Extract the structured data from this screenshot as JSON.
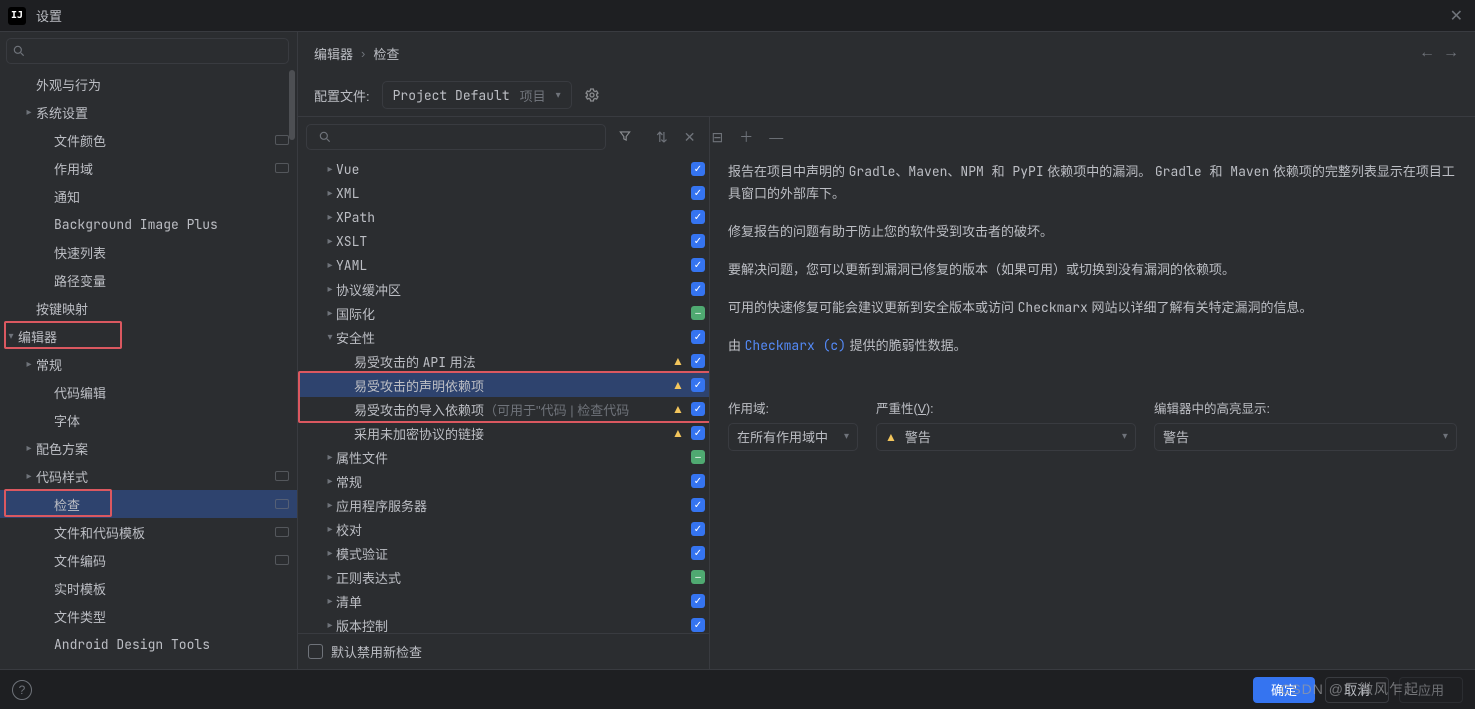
{
  "window": {
    "title": "设置",
    "app_icon_text": "IJ"
  },
  "search": {
    "placeholder": ""
  },
  "sidebar": {
    "items": [
      {
        "label": "外观与行为",
        "indent": 1,
        "chev": "",
        "badge": false
      },
      {
        "label": "系统设置",
        "indent": 1,
        "chev": "right",
        "badge": false
      },
      {
        "label": "文件颜色",
        "indent": 2,
        "chev": "",
        "badge": true
      },
      {
        "label": "作用域",
        "indent": 2,
        "chev": "",
        "badge": true
      },
      {
        "label": "通知",
        "indent": 2,
        "chev": "",
        "badge": false
      },
      {
        "label": "Background Image Plus",
        "indent": 2,
        "mono": true,
        "chev": "",
        "badge": false
      },
      {
        "label": "快速列表",
        "indent": 2,
        "chev": "",
        "badge": false
      },
      {
        "label": "路径变量",
        "indent": 2,
        "chev": "",
        "badge": false
      },
      {
        "label": "按键映射",
        "indent": 1,
        "chev": "",
        "badge": false
      },
      {
        "label": "编辑器",
        "indent": 0,
        "chev": "down",
        "badge": false,
        "hot": true
      },
      {
        "label": "常规",
        "indent": 1,
        "chev": "right",
        "badge": false
      },
      {
        "label": "代码编辑",
        "indent": 2,
        "chev": "",
        "badge": false
      },
      {
        "label": "字体",
        "indent": 2,
        "chev": "",
        "badge": false
      },
      {
        "label": "配色方案",
        "indent": 1,
        "chev": "right",
        "badge": false
      },
      {
        "label": "代码样式",
        "indent": 1,
        "chev": "right",
        "badge": true
      },
      {
        "label": "检查",
        "indent": 2,
        "chev": "",
        "badge": true,
        "selected": true,
        "hot": true
      },
      {
        "label": "文件和代码模板",
        "indent": 2,
        "chev": "",
        "badge": true
      },
      {
        "label": "文件编码",
        "indent": 2,
        "chev": "",
        "badge": true
      },
      {
        "label": "实时模板",
        "indent": 2,
        "chev": "",
        "badge": false
      },
      {
        "label": "文件类型",
        "indent": 2,
        "chev": "",
        "badge": false
      },
      {
        "label": "Android Design Tools",
        "indent": 2,
        "mono": true,
        "chev": "",
        "badge": false
      }
    ]
  },
  "breadcrumb": {
    "parent": "编辑器",
    "child": "检查"
  },
  "profile": {
    "label": "配置文件:",
    "name": "Project Default",
    "suffix": "项目"
  },
  "toolbar_icons": [
    "filter",
    "expand",
    "close",
    "collapse",
    "add",
    "sep"
  ],
  "inspections": [
    {
      "label": "Vue",
      "indent": 1,
      "arrow": "right",
      "chk": "on",
      "mono": true
    },
    {
      "label": "XML",
      "indent": 1,
      "arrow": "right",
      "chk": "on",
      "mono": true
    },
    {
      "label": "XPath",
      "indent": 1,
      "arrow": "right",
      "chk": "on",
      "mono": true
    },
    {
      "label": "XSLT",
      "indent": 1,
      "arrow": "right",
      "chk": "on",
      "mono": true
    },
    {
      "label": "YAML",
      "indent": 1,
      "arrow": "right",
      "chk": "on",
      "mono": true
    },
    {
      "label": "协议缓冲区",
      "indent": 1,
      "arrow": "right",
      "chk": "on"
    },
    {
      "label": "国际化",
      "indent": 1,
      "arrow": "right",
      "chk": "mixed"
    },
    {
      "label": "安全性",
      "indent": 1,
      "arrow": "down",
      "chk": "on"
    },
    {
      "label": "易受攻击的 API 用法",
      "indent": 2,
      "mono_part": true,
      "arrow": "",
      "chk": "on",
      "warn": true
    },
    {
      "label": "易受攻击的声明依赖项",
      "indent": 2,
      "arrow": "",
      "chk": "on",
      "warn": true,
      "selected": true
    },
    {
      "label": "易受攻击的导入依赖项",
      "suffix": "（可用于\"代码 | 检查代码",
      "indent": 2,
      "arrow": "",
      "chk": "on",
      "warn": true
    },
    {
      "label": "采用未加密协议的链接",
      "indent": 2,
      "arrow": "",
      "chk": "on",
      "warn": true
    },
    {
      "label": "属性文件",
      "indent": 1,
      "arrow": "right",
      "chk": "mixed"
    },
    {
      "label": "常规",
      "indent": 1,
      "arrow": "right",
      "chk": "on"
    },
    {
      "label": "应用程序服务器",
      "indent": 1,
      "arrow": "right",
      "chk": "on"
    },
    {
      "label": "校对",
      "indent": 1,
      "arrow": "right",
      "chk": "on"
    },
    {
      "label": "模式验证",
      "indent": 1,
      "arrow": "right",
      "chk": "on"
    },
    {
      "label": "正则表达式",
      "indent": 1,
      "arrow": "right",
      "chk": "mixed"
    },
    {
      "label": "清单",
      "indent": 1,
      "arrow": "right",
      "chk": "on"
    },
    {
      "label": "版本控制",
      "indent": 1,
      "arrow": "right",
      "chk": "on"
    }
  ],
  "disable_new": "默认禁用新检查",
  "desc": {
    "p1a": "报告在项目中声明的 ",
    "p1b": "Gradle、Maven、NPM 和 PyPI",
    "p1c": " 依赖项中的漏洞。 ",
    "p1d": "Gradle 和 Maven",
    "p1e": " 依赖项的完整列表显示在项目工具窗口的外部库下。",
    "p2": "修复报告的问题有助于防止您的软件受到攻击者的破坏。",
    "p3": "要解决问题，您可以更新到漏洞已修复的版本（如果可用）或切换到没有漏洞的依赖项。",
    "p4a": "可用的快速修复可能会建议更新到安全版本或访问 ",
    "p4b": "Checkmarx",
    "p4c": " 网站以详细了解有关特定漏洞的信息。",
    "p5a": "由 ",
    "p5link": "Checkmarx (c)",
    "p5b": " 提供的脆弱性数据。"
  },
  "options": {
    "scope_label": "作用域:",
    "scope_value": "在所有作用域中",
    "sev_label_a": "严重性(",
    "sev_label_b": "V",
    "sev_label_c": "):",
    "sev_value": "警告",
    "hl_label": "编辑器中的高亮显示:",
    "hl_value": "警告"
  },
  "buttons": {
    "ok": "确定",
    "cancel": "取消",
    "apply": "应用"
  },
  "watermark": "CSDN @厂微风乍起"
}
